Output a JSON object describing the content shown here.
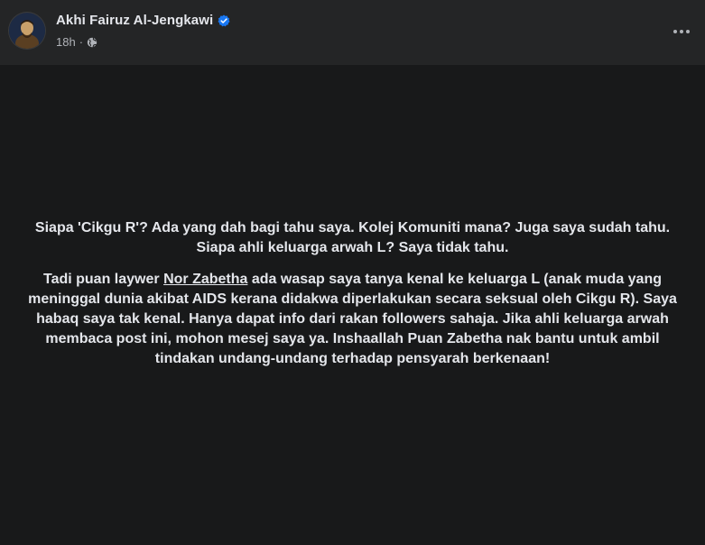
{
  "post": {
    "author": {
      "name": "Akhi Fairuz Al-Jengkawi",
      "verified": true,
      "avatar_icon": "profile-photo"
    },
    "timestamp": "18h",
    "separator": "·",
    "privacy_icon": "globe-icon",
    "more_icon": "ellipsis-icon",
    "body": {
      "paragraph1": "Siapa 'Cikgu R'? Ada yang dah bagi tahu saya. Kolej Komuniti mana? Juga saya sudah tahu. Siapa ahli keluarga arwah L? Saya tidak tahu.",
      "paragraph2_before": "Tadi puan laywer ",
      "mention": "Nor Zabetha",
      "paragraph2_after": " ada wasap saya tanya kenal ke keluarga L (anak muda yang meninggal dunia akibat AIDS kerana didakwa diperlakukan secara seksual oleh Cikgu R). Saya habaq saya tak kenal. Hanya dapat info dari rakan followers sahaja. Jika ahli keluarga arwah membaca post ini, mohon mesej saya ya. Inshaallah Puan Zabetha nak bantu untuk ambil tindakan undang-undang terhadap pensyarah berkenaan!"
    }
  },
  "colors": {
    "header_bg": "#242526",
    "body_bg": "#18191a",
    "text": "#e4e6eb",
    "meta_text": "#b0b3b8",
    "verified_blue": "#1877f2"
  }
}
